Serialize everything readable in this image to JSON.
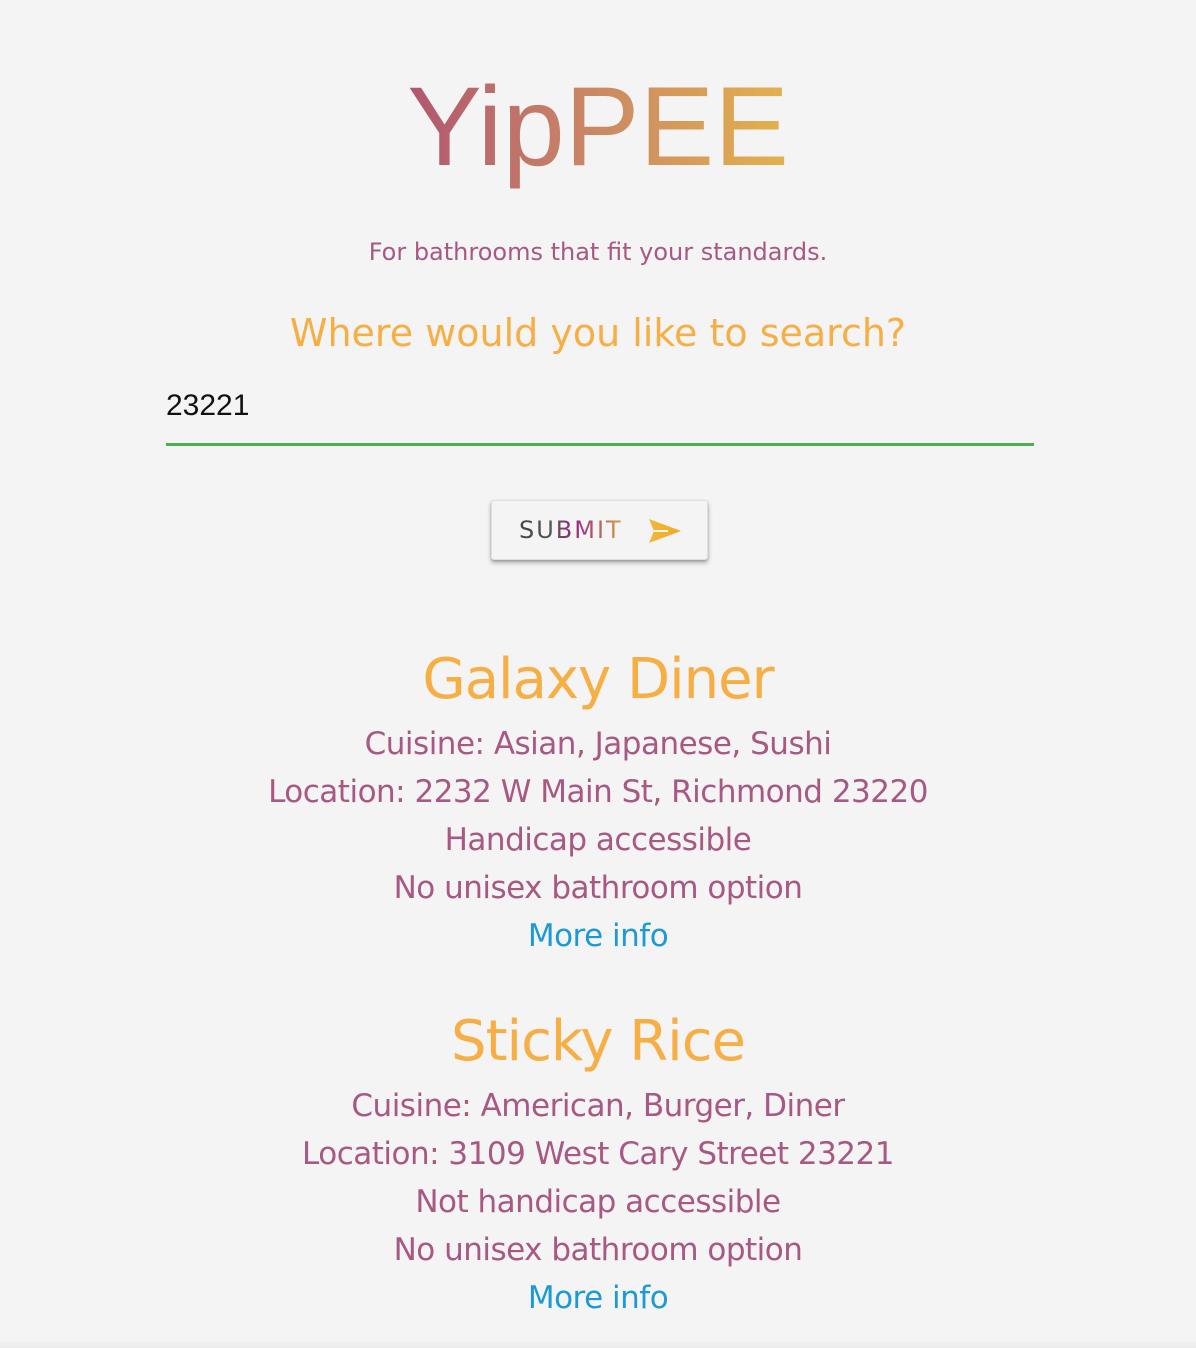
{
  "header": {
    "title": "YipPEE",
    "tagline": "For bathrooms that fit your standards."
  },
  "search": {
    "prompt": "Where would you like to search?",
    "value": "23221",
    "placeholder": ""
  },
  "submit": {
    "label": "SUBMIT",
    "icon": "send-icon"
  },
  "results": [
    {
      "name": "Galaxy Diner",
      "cuisine": "Cuisine: Asian, Japanese, Sushi",
      "location": "Location: 2232 W Main St, Richmond 23220",
      "accessibility": "Handicap accessible",
      "unisex": "No unisex bathroom option",
      "link": "More info"
    },
    {
      "name": "Sticky Rice",
      "cuisine": "Cuisine: American, Burger, Diner",
      "location": "Location: 3109 West Cary Street 23221",
      "accessibility": "Not handicap accessible",
      "unisex": "No unisex bathroom option",
      "link": "More info"
    }
  ],
  "colors": {
    "background": "#f4f4f4",
    "accent_orange": "#f7ae44",
    "text_mauve": "#a75883",
    "link_blue": "#1d9ad6",
    "input_underline": "#4caf50"
  }
}
